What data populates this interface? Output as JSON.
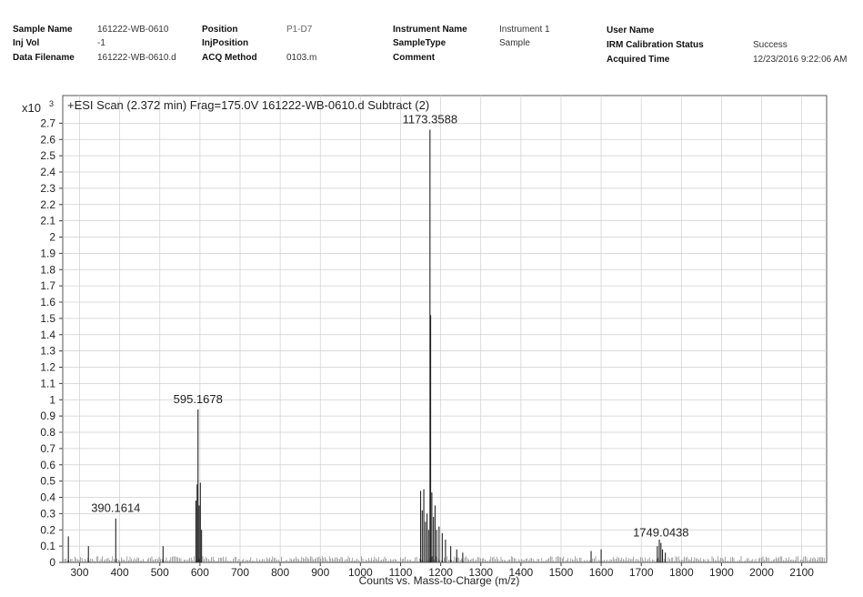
{
  "header": {
    "sample_name_label": "Sample Name",
    "sample_name": "161222-WB-0610",
    "inj_vol_label": "Inj Vol",
    "inj_vol": "-1",
    "data_filename_label": "Data Filename",
    "data_filename": "161222-WB-0610.d",
    "position_label": "Position",
    "position": "P1-D7",
    "inj_position_label": "InjPosition",
    "acq_method_label": "ACQ Method",
    "acq_method": "0103.m",
    "instrument_name_label": "Instrument Name",
    "instrument_name": "Instrument 1",
    "sample_type_label": "SampleType",
    "sample_type": "Sample",
    "comment_label": "Comment",
    "user_name_label": "User Name",
    "irm_label": "IRM Calibration Status",
    "irm_status": "Success",
    "acquired_time_label": "Acquired Time",
    "acquired_time": "12/23/2016 9:22:06 AM"
  },
  "chart_data": {
    "type": "bar",
    "title": "+ESI Scan (2.372 min) Frag=175.0V 161222-WB-0610.d  Subtract (2)",
    "xlabel": "Counts vs. Mass-to-Charge (m/z)",
    "ylabel": "",
    "y_multiplier": "x10",
    "y_exponent": "3",
    "xlim": [
      258,
      2162
    ],
    "ylim": [
      0,
      2.87
    ],
    "x_ticks": [
      300,
      400,
      500,
      600,
      700,
      800,
      900,
      1000,
      1100,
      1200,
      1300,
      1400,
      1500,
      1600,
      1700,
      1800,
      1900,
      2000,
      2100
    ],
    "y_ticks": [
      0,
      0.1,
      0.2,
      0.3,
      0.4,
      0.5,
      0.6,
      0.7,
      0.8,
      0.9,
      1,
      1.1,
      1.2,
      1.3,
      1.4,
      1.5,
      1.6,
      1.7,
      1.8,
      1.9,
      2,
      2.1,
      2.2,
      2.3,
      2.4,
      2.5,
      2.6,
      2.7
    ],
    "grid": true,
    "peaks": [
      {
        "x": 272,
        "y": 0.16
      },
      {
        "x": 322,
        "y": 0.1
      },
      {
        "x": 390.1614,
        "y": 0.27
      },
      {
        "x": 508,
        "y": 0.1
      },
      {
        "x": 590,
        "y": 0.38
      },
      {
        "x": 593,
        "y": 0.48
      },
      {
        "x": 595.1678,
        "y": 0.94
      },
      {
        "x": 598,
        "y": 0.35
      },
      {
        "x": 601,
        "y": 0.49
      },
      {
        "x": 604,
        "y": 0.2
      },
      {
        "x": 1150,
        "y": 0.44
      },
      {
        "x": 1154,
        "y": 0.32
      },
      {
        "x": 1158,
        "y": 0.45
      },
      {
        "x": 1162,
        "y": 0.25
      },
      {
        "x": 1166,
        "y": 0.3
      },
      {
        "x": 1170,
        "y": 0.2
      },
      {
        "x": 1173.3588,
        "y": 2.66
      },
      {
        "x": 1175,
        "y": 1.52
      },
      {
        "x": 1178,
        "y": 0.43
      },
      {
        "x": 1182,
        "y": 0.28
      },
      {
        "x": 1186,
        "y": 0.35
      },
      {
        "x": 1190,
        "y": 0.2
      },
      {
        "x": 1196,
        "y": 0.22
      },
      {
        "x": 1204,
        "y": 0.18
      },
      {
        "x": 1212,
        "y": 0.14
      },
      {
        "x": 1225,
        "y": 0.1
      },
      {
        "x": 1240,
        "y": 0.08
      },
      {
        "x": 1255,
        "y": 0.06
      },
      {
        "x": 1575,
        "y": 0.07
      },
      {
        "x": 1600,
        "y": 0.08
      },
      {
        "x": 1740,
        "y": 0.1
      },
      {
        "x": 1745,
        "y": 0.14
      },
      {
        "x": 1749.0438,
        "y": 0.12
      },
      {
        "x": 1753,
        "y": 0.08
      },
      {
        "x": 1760,
        "y": 0.06
      }
    ],
    "annotations": [
      {
        "text": "390.1614",
        "x": 390.1614,
        "y": 0.27
      },
      {
        "text": "595.1678",
        "x": 595.1678,
        "y": 0.94
      },
      {
        "text": "1173.3588",
        "x": 1173.3588,
        "y": 2.66
      },
      {
        "text": "1749.0438",
        "x": 1749.0438,
        "y": 0.12
      }
    ]
  }
}
